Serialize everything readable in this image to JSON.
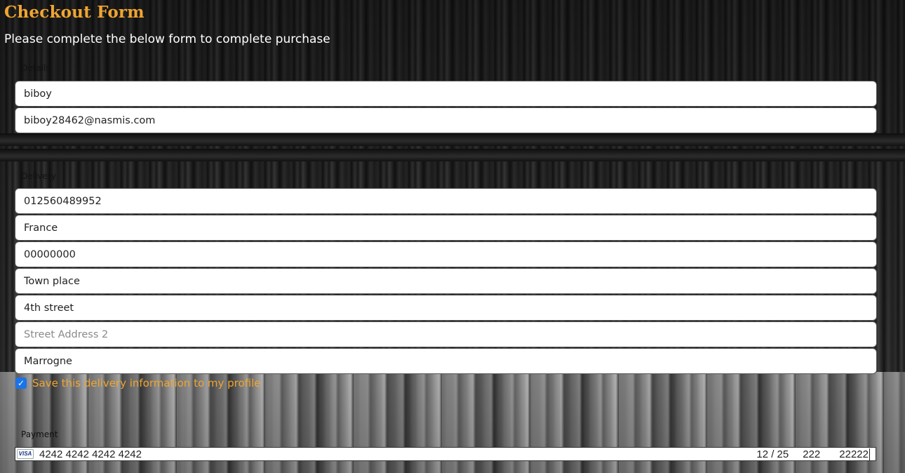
{
  "page": {
    "title": "Checkout Form",
    "subtitle": "Please complete the below form to complete purchase"
  },
  "details": {
    "legend": "Details",
    "full_name": "biboy",
    "email": "biboy28462@nasmis.com"
  },
  "delivery": {
    "legend": "Delivery",
    "phone": "012560489952",
    "country": "France",
    "postcode": "00000000",
    "town": "Town place",
    "street1": "4th street",
    "street2_placeholder": "Street Address 2",
    "county": "Marrogne",
    "save_label": "Save this delivery information to my profile",
    "save_checked": true
  },
  "payment": {
    "legend": "Payment",
    "card_brand": "VISA",
    "card_number": "4242 4242 4242 4242",
    "expiry": "12 / 25",
    "cvc": "222",
    "zip": "22222"
  },
  "colors": {
    "accent": "#f0a530",
    "checkbox": "#1a73e8"
  }
}
